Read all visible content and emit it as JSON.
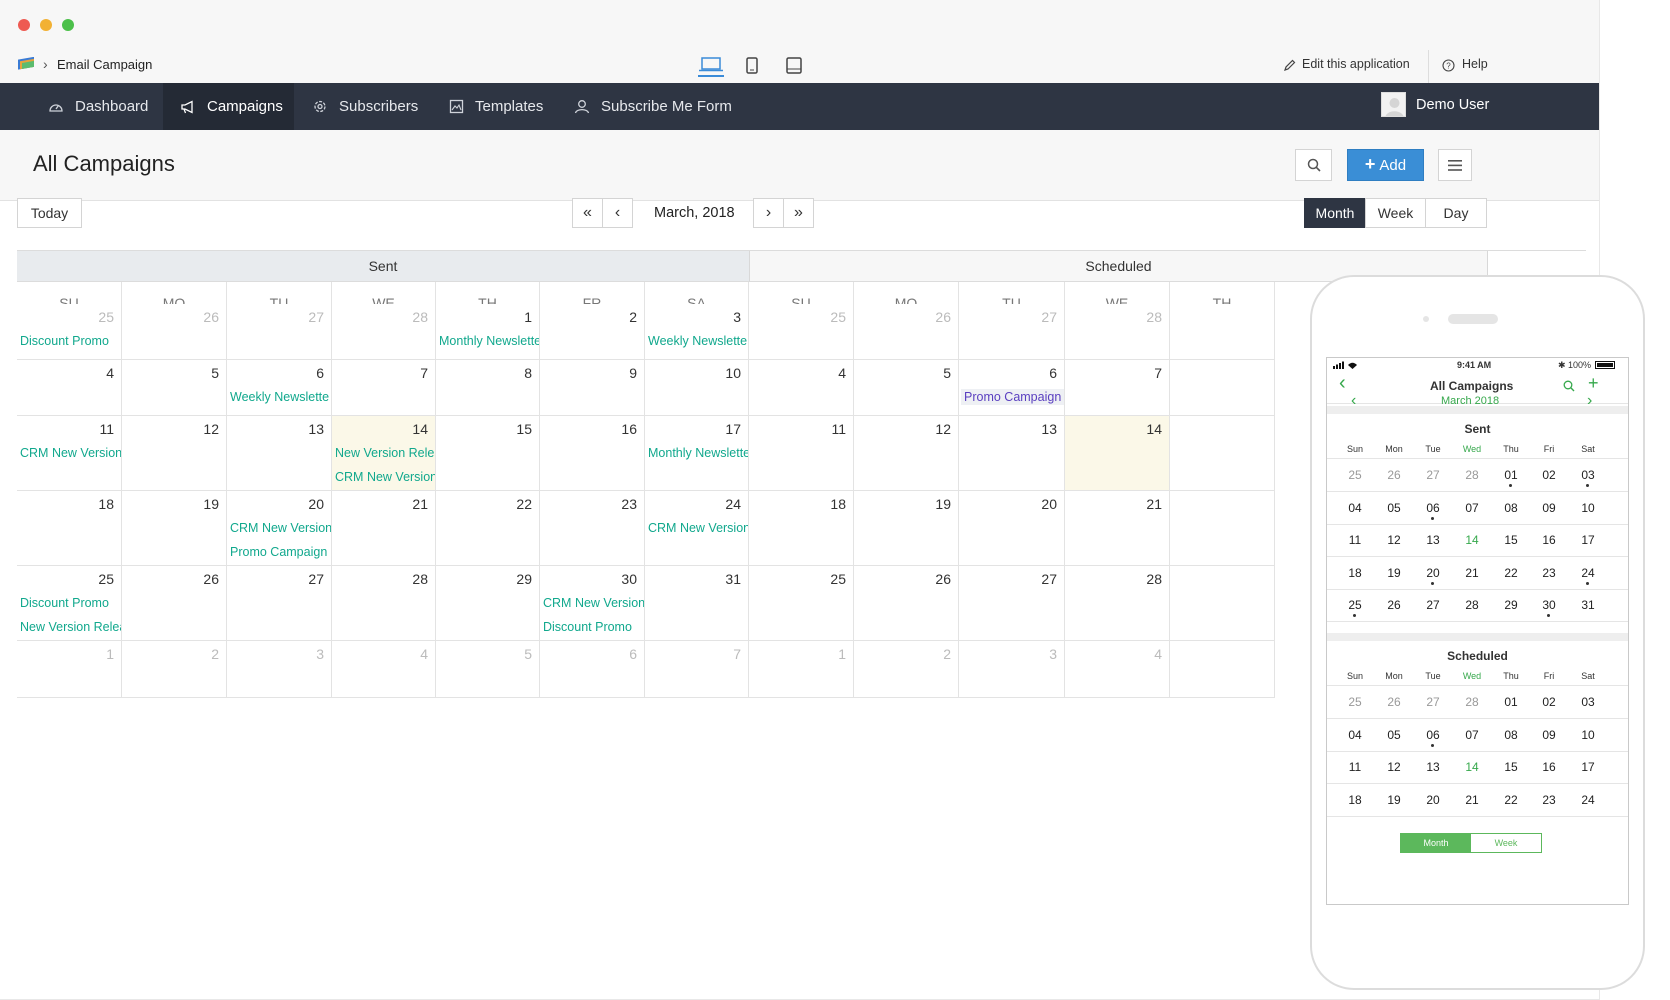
{
  "app": {
    "breadcrumb": "Email Campaign",
    "edit_label": "Edit this application",
    "help_label": "Help"
  },
  "nav": {
    "items": [
      {
        "label": "Dashboard",
        "icon": "dashboard-icon"
      },
      {
        "label": "Campaigns",
        "icon": "megaphone-icon"
      },
      {
        "label": "Subscribers",
        "icon": "subscribers-icon"
      },
      {
        "label": "Templates",
        "icon": "templates-icon"
      },
      {
        "label": "Subscribe Me Form",
        "icon": "user-icon"
      }
    ],
    "active": "Campaigns",
    "user": "Demo User"
  },
  "page": {
    "title": "All Campaigns",
    "add_label": "Add"
  },
  "calendar": {
    "today_label": "Today",
    "month_label": "March, 2018",
    "views": [
      "Month",
      "Week",
      "Day"
    ],
    "active_view": "Month",
    "groups": [
      "Sent",
      "Scheduled"
    ],
    "day_headers": [
      "SU",
      "MO",
      "TU",
      "WE",
      "TH",
      "FR",
      "SA"
    ],
    "sent_weeks": [
      [
        {
          "d": "25",
          "o": true,
          "ev": [
            "Discount Promo"
          ]
        },
        {
          "d": "26",
          "o": true
        },
        {
          "d": "27",
          "o": true
        },
        {
          "d": "28",
          "o": true
        },
        {
          "d": "1",
          "ev": [
            "Monthly Newslette"
          ]
        },
        {
          "d": "2"
        },
        {
          "d": "3",
          "ev": [
            "Weekly Newslette"
          ]
        }
      ],
      [
        {
          "d": "4"
        },
        {
          "d": "5"
        },
        {
          "d": "6",
          "ev": [
            "Weekly Newslette"
          ]
        },
        {
          "d": "7"
        },
        {
          "d": "8"
        },
        {
          "d": "9"
        },
        {
          "d": "10"
        }
      ],
      [
        {
          "d": "11",
          "ev": [
            "CRM New Version"
          ]
        },
        {
          "d": "12"
        },
        {
          "d": "13"
        },
        {
          "d": "14",
          "t": true,
          "ev": [
            "New Version Relea",
            "CRM New Version"
          ]
        },
        {
          "d": "15"
        },
        {
          "d": "16"
        },
        {
          "d": "17",
          "ev": [
            "Monthly Newslette"
          ]
        }
      ],
      [
        {
          "d": "18"
        },
        {
          "d": "19"
        },
        {
          "d": "20",
          "ev": [
            "CRM New Version",
            "Promo Campaign"
          ]
        },
        {
          "d": "21"
        },
        {
          "d": "22"
        },
        {
          "d": "23"
        },
        {
          "d": "24",
          "ev": [
            "CRM New Version"
          ]
        }
      ],
      [
        {
          "d": "25",
          "ev": [
            "Discount Promo",
            "New Version Relea"
          ]
        },
        {
          "d": "26"
        },
        {
          "d": "27"
        },
        {
          "d": "28"
        },
        {
          "d": "29"
        },
        {
          "d": "30",
          "ev": [
            "CRM New Version",
            "Discount Promo"
          ]
        },
        {
          "d": "31"
        }
      ],
      [
        {
          "d": "1",
          "o": true
        },
        {
          "d": "2",
          "o": true
        },
        {
          "d": "3",
          "o": true
        },
        {
          "d": "4",
          "o": true
        },
        {
          "d": "5",
          "o": true
        },
        {
          "d": "6",
          "o": true
        },
        {
          "d": "7",
          "o": true
        }
      ]
    ],
    "sched_weeks": [
      [
        {
          "d": "25",
          "o": true
        },
        {
          "d": "26",
          "o": true
        },
        {
          "d": "27",
          "o": true
        },
        {
          "d": "28",
          "o": true
        },
        {
          "d": ""
        }
      ],
      [
        {
          "d": "4"
        },
        {
          "d": "5"
        },
        {
          "d": "6",
          "pev": [
            "Promo Campaign"
          ]
        },
        {
          "d": "7"
        },
        {
          "d": ""
        }
      ],
      [
        {
          "d": "11"
        },
        {
          "d": "12"
        },
        {
          "d": "13"
        },
        {
          "d": "14",
          "t": true
        },
        {
          "d": ""
        }
      ],
      [
        {
          "d": "18"
        },
        {
          "d": "19"
        },
        {
          "d": "20"
        },
        {
          "d": "21"
        },
        {
          "d": ""
        }
      ],
      [
        {
          "d": "25"
        },
        {
          "d": "26"
        },
        {
          "d": "27"
        },
        {
          "d": "28"
        },
        {
          "d": ""
        }
      ],
      [
        {
          "d": "1",
          "o": true
        },
        {
          "d": "2",
          "o": true
        },
        {
          "d": "3",
          "o": true
        },
        {
          "d": "4",
          "o": true
        },
        {
          "d": ""
        }
      ]
    ]
  },
  "mobile": {
    "status": {
      "time": "9:41 AM",
      "battery": "100%"
    },
    "title": "All Campaigns",
    "month": "March 2018",
    "sent_label": "Sent",
    "sched_label": "Scheduled",
    "weekdays": [
      "Sun",
      "Mon",
      "Tue",
      "Wed",
      "Thu",
      "Fri",
      "Sat"
    ],
    "sent_rows": [
      [
        "25",
        "26",
        "27",
        "28",
        "01",
        "02",
        "03"
      ],
      [
        "04",
        "05",
        "06",
        "07",
        "08",
        "09",
        "10"
      ],
      [
        "11",
        "12",
        "13",
        "14",
        "15",
        "16",
        "17"
      ],
      [
        "18",
        "19",
        "20",
        "21",
        "22",
        "23",
        "24"
      ],
      [
        "25",
        "26",
        "27",
        "28",
        "29",
        "30",
        "31"
      ]
    ],
    "sched_rows": [
      [
        "25",
        "26",
        "27",
        "28",
        "01",
        "02",
        "03"
      ],
      [
        "04",
        "05",
        "06",
        "07",
        "08",
        "09",
        "10"
      ],
      [
        "11",
        "12",
        "13",
        "14",
        "15",
        "16",
        "17"
      ],
      [
        "18",
        "19",
        "20",
        "21",
        "22",
        "23",
        "24"
      ]
    ],
    "toggle": [
      "Month",
      "Week"
    ]
  }
}
